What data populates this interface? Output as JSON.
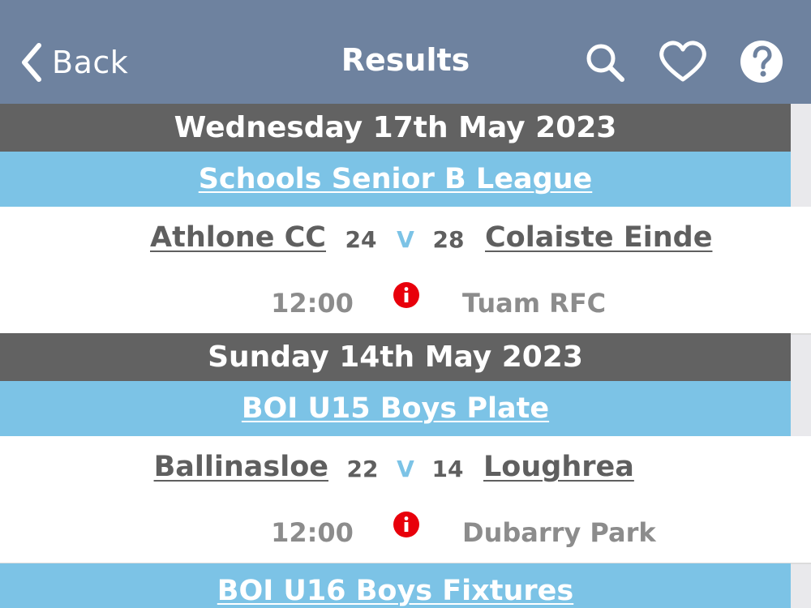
{
  "navbar": {
    "back_label": "Back",
    "title": "Results",
    "icons": [
      "search-icon",
      "heart-icon",
      "help-icon"
    ],
    "background_color": "#6e829f"
  },
  "sections": [
    {
      "date": "Wednesday 17th May 2023",
      "league": "Schools Senior B League",
      "match": {
        "home_team": "Athlone CC",
        "home_score": "24",
        "vs": "V",
        "away_score": "28",
        "away_team": "Colaiste Einde",
        "time": "12:00",
        "venue": "Tuam RFC"
      }
    },
    {
      "date": "Sunday 14th May 2023",
      "league": "BOI U15 Boys Plate",
      "match": {
        "home_team": "Ballinasloe",
        "home_score": "22",
        "vs": "V",
        "away_score": "14",
        "away_team": "Loughrea",
        "time": "12:00",
        "venue": "Dubarry Park"
      }
    },
    {
      "league": "BOI U16 Boys Fixtures"
    }
  ],
  "colors": {
    "date_header": "#626262",
    "league_header": "#7cc3e6",
    "team_text": "#5f5f5f",
    "secondary_text": "#8c8c8c",
    "info_icon": "#e8000b"
  }
}
